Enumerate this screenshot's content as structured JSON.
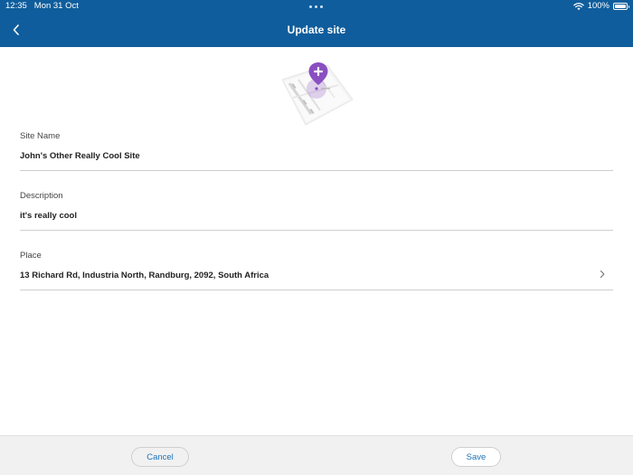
{
  "status_bar": {
    "time": "12:35",
    "date": "Mon 31 Oct",
    "battery": "100%",
    "wifi_icon": "wifi-icon",
    "battery_icon": "battery-icon"
  },
  "nav": {
    "title": "Update site",
    "back_icon": "chevron-left-icon"
  },
  "form": {
    "site_name": {
      "label": "Site Name",
      "value": "John's Other Really Cool Site"
    },
    "description": {
      "label": "Description",
      "value": "it's really cool"
    },
    "place": {
      "label": "Place",
      "value": "13 Richard Rd, Industria North, Randburg, 2092, South Africa",
      "chevron_icon": "chevron-right-icon"
    }
  },
  "footer": {
    "cancel_label": "Cancel",
    "save_label": "Save"
  },
  "colors": {
    "header": "#0f5d9c",
    "accent": "#1c73b8",
    "pin": "#8a4fc1",
    "footer_bg": "#f1f1f1"
  }
}
